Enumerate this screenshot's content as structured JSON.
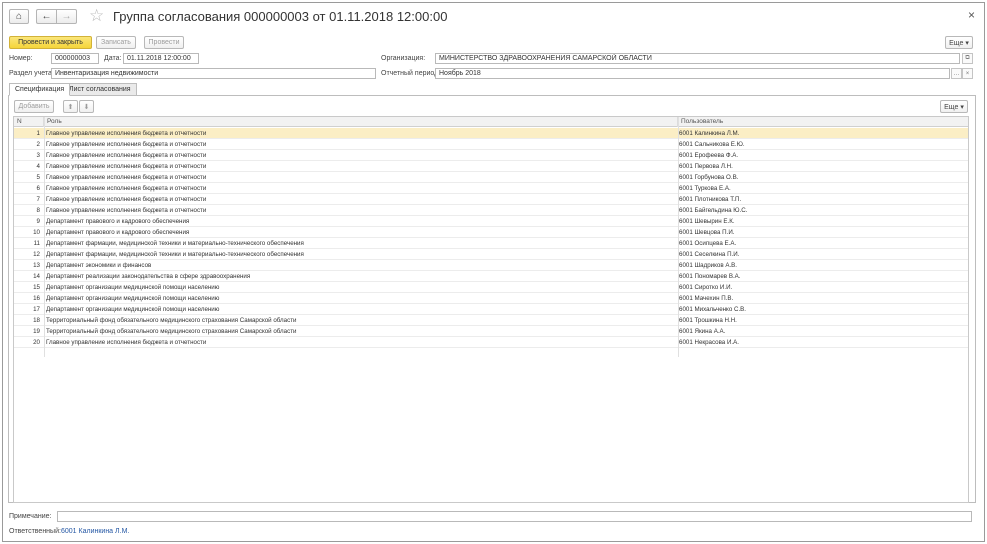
{
  "window": {
    "title": "Группа согласования 000000003 от 01.11.2018 12:00:00",
    "close": "×"
  },
  "nav": {
    "home": "⌂",
    "back": "←",
    "forward": "→",
    "favorite": "☆"
  },
  "commands": {
    "post_close": "Провести и закрыть",
    "write": "Записать",
    "post": "Провести",
    "more": "Еще ▾"
  },
  "form": {
    "number_label": "Номер:",
    "number": "000000003",
    "date_label": "Дата:",
    "date": "01.11.2018 12:00:00",
    "org_label": "Организация:",
    "org": "МИНИСТЕРСТВО ЗДРАВООХРАНЕНИЯ САМАРСКОЙ ОБЛАСТИ",
    "section_label": "Раздел учета:",
    "section": "Инвентаризация недвижимости",
    "period_label": "Отчетный период:",
    "period": "Ноябрь 2018",
    "note_label": "Примечание:",
    "note": "",
    "responsible_label": "Ответственный:",
    "responsible": "6001 Калинкина Л.М."
  },
  "tabs": [
    {
      "label": "Спецификация",
      "active": true
    },
    {
      "label": "Лист согласования",
      "active": false
    }
  ],
  "table_bar": {
    "add": "Добавить",
    "up": "⬆",
    "down": "⬇",
    "more": "Еще ▾"
  },
  "table": {
    "headers": {
      "n": "N",
      "role": "Роль",
      "user": "Пользователь"
    },
    "rows": [
      {
        "n": "1",
        "role": "Главное управление исполнения бюджета и отчетности",
        "user": "6001 Калинкина Л.М."
      },
      {
        "n": "2",
        "role": "Главное управление исполнения бюджета и отчетности",
        "user": "6001 Сальникова Е.Ю."
      },
      {
        "n": "3",
        "role": "Главное управление исполнения бюджета и отчетности",
        "user": "6001 Ерофеева Ф.А."
      },
      {
        "n": "4",
        "role": "Главное управление исполнения бюджета и отчетности",
        "user": "6001 Первова Л.Н."
      },
      {
        "n": "5",
        "role": "Главное управление исполнения бюджета и отчетности",
        "user": "6001 Горбунова О.В."
      },
      {
        "n": "6",
        "role": "Главное управление исполнения бюджета и отчетности",
        "user": "6001 Туркова Е.А."
      },
      {
        "n": "7",
        "role": "Главное управление исполнения бюджета и отчетности",
        "user": "6001 Плотникова Т.П."
      },
      {
        "n": "8",
        "role": "Главное управление исполнения бюджета и отчетности",
        "user": "6001 Байгельдина Ю.С."
      },
      {
        "n": "9",
        "role": "Департамент правового и кадрового обеспечения",
        "user": "6001 Шевырин Е.К."
      },
      {
        "n": "10",
        "role": "Департамент правового и кадрового обеспечения",
        "user": "6001 Шевцова П.И."
      },
      {
        "n": "11",
        "role": "Департамент фармации, медицинской техники и материально-технического обеспечения",
        "user": "6001 Осипцева Е.А."
      },
      {
        "n": "12",
        "role": "Департамент фармации, медицинской техники и материально-технического обеспечения",
        "user": "6001 Сеселкина П.И."
      },
      {
        "n": "13",
        "role": "Департамент экономики и финансов",
        "user": "6001 Шадриков А.В."
      },
      {
        "n": "14",
        "role": "Департамент реализации законодательства в сфере здравоохранения",
        "user": "6001 Пономарев В.А."
      },
      {
        "n": "15",
        "role": "Департамент организации медицинской помощи населению",
        "user": "6001 Сиротко И.И."
      },
      {
        "n": "16",
        "role": "Департамент организации медицинской помощи населению",
        "user": "6001 Мачехин П.В."
      },
      {
        "n": "17",
        "role": "Департамент организации медицинской помощи населению",
        "user": "6001 Михальченко С.В."
      },
      {
        "n": "18",
        "role": "Территориальный фонд обязательного медицинского страхования Самарской области",
        "user": "6001 Трошкина Н.Н."
      },
      {
        "n": "19",
        "role": "Территориальный фонд обязательного медицинского страхования Самарской области",
        "user": "6001 Якина А.А."
      },
      {
        "n": "20",
        "role": "Главное управление исполнения бюджета и отчетности",
        "user": "6001 Некрасова И.А."
      }
    ]
  }
}
